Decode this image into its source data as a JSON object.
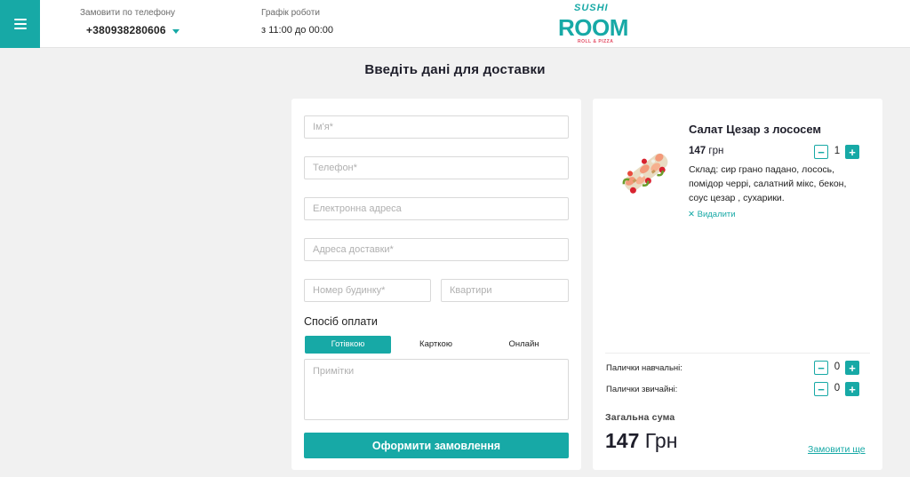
{
  "header": {
    "phone_label": "Замовити по телефону",
    "phone": "+380938280606",
    "hours_label": "Графік роботи",
    "hours": "з 11:00 до 00:00",
    "logo_top": "SUSHI",
    "logo_main": "ROOM",
    "logo_sub": "ROLL & PIZZA"
  },
  "page": {
    "title": "Введіть дані для доставки"
  },
  "form": {
    "name_placeholder": "Ім'я*",
    "phone_placeholder": "Телефон*",
    "email_placeholder": "Електронна адреса",
    "address_placeholder": "Адреса доставки*",
    "house_placeholder": "Номер будинку*",
    "apartment_placeholder": "Квартири",
    "payment_title": "Спосіб оплати",
    "payment_options": [
      {
        "label": "Готівкою",
        "selected": true
      },
      {
        "label": "Карткою",
        "selected": false
      },
      {
        "label": "Онлайн",
        "selected": false
      }
    ],
    "notes_placeholder": "Примітки",
    "submit_label": "Оформити замовлення"
  },
  "cart": {
    "item": {
      "name": "Салат Цезар з лососем",
      "price_value": "147",
      "price_unit": "грн",
      "quantity": "1",
      "description": "Склад: сир грано падано, лосось, помідор черрі, салатний мікс, бекон, соус цезар , сухарики.",
      "remove_label": "Видалити"
    },
    "sticks": [
      {
        "label": "Палички навчальні:",
        "quantity": "0"
      },
      {
        "label": "Палички звичайні:",
        "quantity": "0"
      }
    ],
    "total_label": "Загальна сума",
    "total_value": "147",
    "total_unit": "Грн",
    "order_more_label": "Замовити ще"
  },
  "colors": {
    "accent": "#17a9a6",
    "background": "#f1f1f1",
    "logo_sub": "#e34c63"
  }
}
